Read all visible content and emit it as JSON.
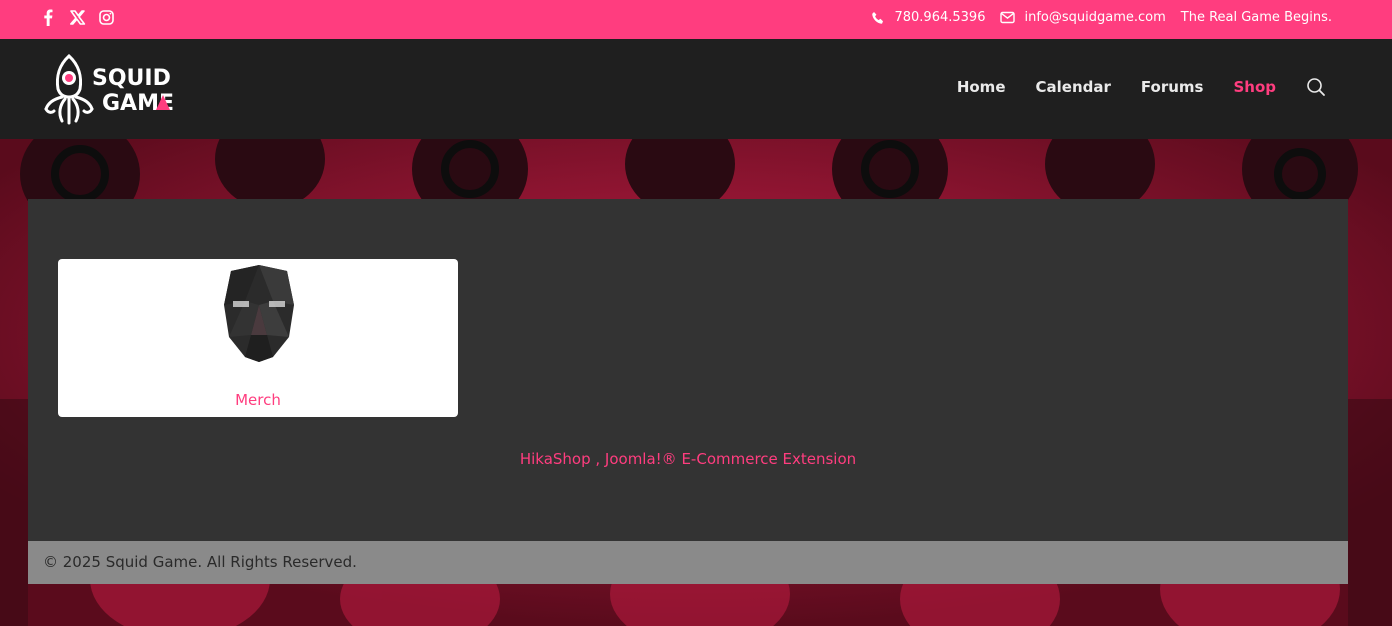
{
  "topbar": {
    "social": [
      "facebook-icon",
      "x-icon",
      "instagram-icon"
    ],
    "phone": "780.964.5396",
    "email": "info@squidgame.com",
    "tagline": "The Real Game Begins."
  },
  "header": {
    "logo_line1": "SQUID",
    "logo_line2": "GAME",
    "nav": [
      {
        "label": "Home",
        "active": false
      },
      {
        "label": "Calendar",
        "active": false
      },
      {
        "label": "Forums",
        "active": false
      },
      {
        "label": "Shop",
        "active": true
      }
    ]
  },
  "main": {
    "category_card": {
      "title": "Merch"
    },
    "powered_by": "HikaShop , Joomla!® E-Commerce Extension"
  },
  "footer": {
    "copyright": "© 2025 Squid Game. All Rights Reserved."
  },
  "colors": {
    "accent": "#ff3d7f",
    "header_bg": "#1f1f1f",
    "panel_bg": "#333333",
    "footer_bg": "#8a8a8a"
  }
}
